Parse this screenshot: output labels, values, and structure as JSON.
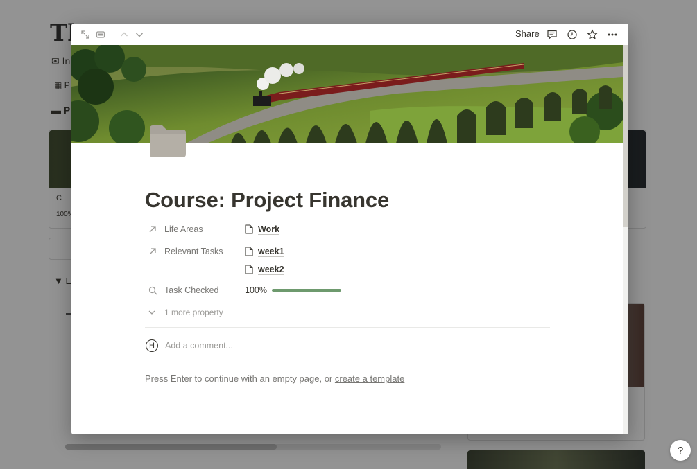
{
  "background": {
    "title": "Th",
    "inbox_label": "In",
    "tab_label": "P",
    "folder_label": "P",
    "card_title": "C",
    "card_progress": "100%",
    "toggle_label": "E"
  },
  "modal": {
    "toolbar": {
      "share_label": "Share"
    },
    "icons": {
      "expand": "expand-icon",
      "peek_mode": "peek-mode-icon",
      "prev": "chevron-up-icon",
      "next": "chevron-down-icon",
      "comments": "comment-icon",
      "updates": "clock-icon",
      "favorite": "star-icon",
      "more": "more-icon",
      "page_icon": "folder-icon"
    },
    "title": "Course: Project Finance",
    "properties": [
      {
        "label": "Life Areas",
        "icon": "arrow-up-right-icon",
        "values": [
          "Work"
        ]
      },
      {
        "label": "Relevant Tasks",
        "icon": "arrow-up-right-icon",
        "values": [
          "week1",
          "week2"
        ]
      },
      {
        "label": "Task Checked",
        "icon": "search-icon",
        "value_text": "100%",
        "progress": 1.0
      }
    ],
    "more_property_label": "1 more property",
    "comment_placeholder": "Add a comment...",
    "comment_avatar": "H",
    "empty_hint": "Press Enter to continue with an empty page, or ",
    "empty_hint_link": "create a template"
  },
  "help_label": "?",
  "colors": {
    "accent_progress": "#6e9a6e",
    "text": "#37352f",
    "muted": "#787774"
  }
}
